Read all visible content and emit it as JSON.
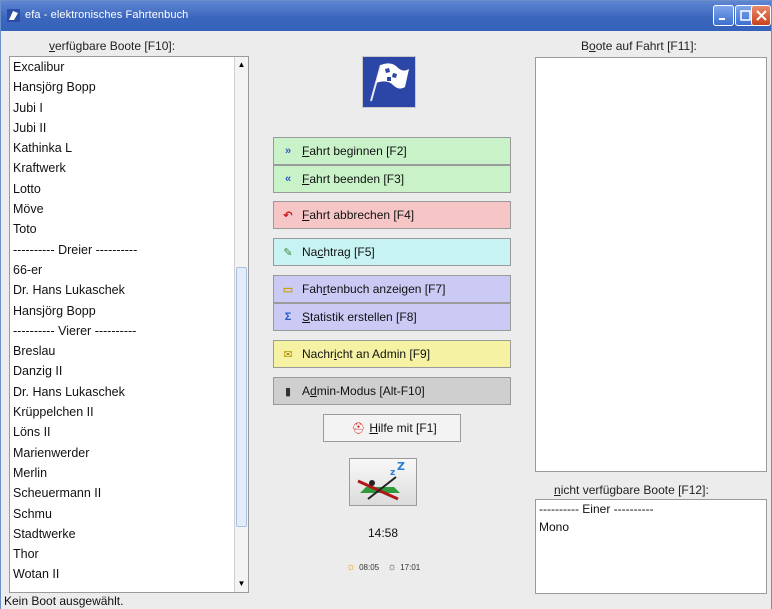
{
  "window": {
    "title": "efa - elektronisches Fahrtenbuch"
  },
  "lists": {
    "available": {
      "label_prefix": "",
      "label_mnemonic": "v",
      "label_rest": "erfügbare Boote [F10]:",
      "items": [
        "Excalibur",
        "Hansjörg Bopp",
        "Jubi I",
        "Jubi II",
        "Kathinka L",
        "Kraftwerk",
        "Lotto",
        "Möve",
        "Toto",
        "---------- Dreier ----------",
        "66-er",
        "Dr. Hans Lukaschek",
        "Hansjörg Bopp",
        "---------- Vierer ----------",
        "Breslau",
        "Danzig II",
        "Dr. Hans Lukaschek",
        "Krüppelchen II",
        "Löns II",
        "Marienwerder",
        "Merlin",
        "Scheuermann II",
        "Schmu",
        "Stadtwerke",
        "Thor",
        "Wotan II"
      ]
    },
    "on_trip": {
      "label_prefix": "B",
      "label_mnemonic": "o",
      "label_rest": "ote auf Fahrt [F11]:"
    },
    "unavailable": {
      "label_prefix": "",
      "label_mnemonic": "n",
      "label_rest": "icht verfügbare Boote [F12]:",
      "items": [
        "---------- Einer ----------",
        "Mono"
      ]
    }
  },
  "buttons": {
    "begin": {
      "pre": "",
      "mn": "F",
      "post": "ahrt beginnen [F2]",
      "icon": "»"
    },
    "end": {
      "pre": "",
      "mn": "F",
      "post": "ahrt beenden [F3]",
      "icon": "«"
    },
    "abort": {
      "pre": "",
      "mn": "F",
      "post": "ahrt abbrechen [F4]",
      "icon": "↶"
    },
    "nach": {
      "pre": "Na",
      "mn": "c",
      "post": "htrag [F5]",
      "icon": "✎"
    },
    "book": {
      "pre": "Fah",
      "mn": "r",
      "post": "tenbuch anzeigen [F7]",
      "icon": "▭"
    },
    "stat": {
      "pre": "",
      "mn": "S",
      "post": "tatistik erstellen [F8]",
      "icon": "Σ"
    },
    "msg": {
      "pre": "Nachr",
      "mn": "i",
      "post": "cht an Admin [F9]",
      "icon": "✉"
    },
    "admin": {
      "pre": "A",
      "mn": "d",
      "post": "min-Modus [Alt-F10]",
      "icon": "▮"
    },
    "help": {
      "pre": "",
      "mn": "H",
      "post": "ilfe mit [F1]",
      "icon": "⛑"
    }
  },
  "clock": {
    "time": "14:58"
  },
  "sun": {
    "sunrise": "08:05",
    "sunset": "17:01"
  },
  "status": {
    "text": "Kein Boot ausgewählt."
  },
  "colors": {
    "start_end": "#c9f2c9",
    "abort": "#f6c6c6",
    "nachtrag": "#c8f3f3",
    "logbook": "#cacaf5",
    "message": "#f5f2a4",
    "admin": "#cfcfcf",
    "titlebar": "#3c66bd"
  }
}
